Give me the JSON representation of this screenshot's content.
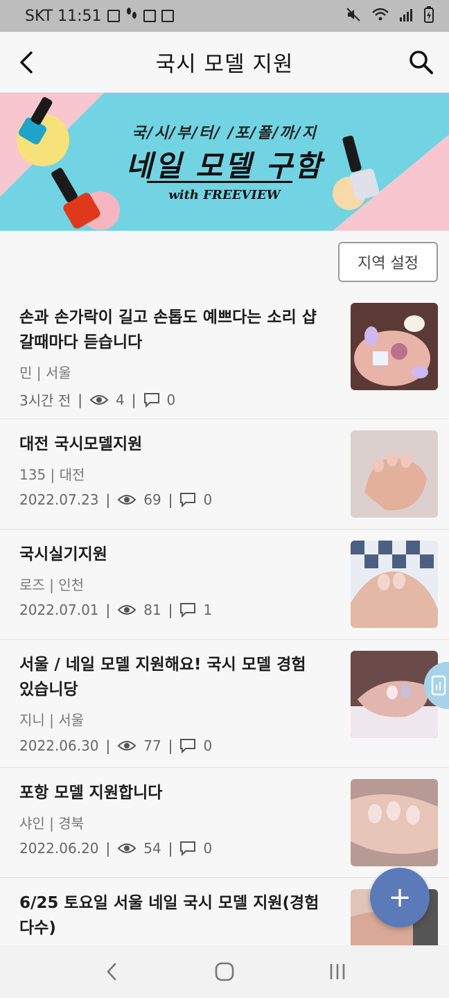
{
  "status_bar": {
    "carrier_time": "SKT 11:51"
  },
  "app_bar": {
    "title": "국시 모델 지원"
  },
  "banner": {
    "top_text": "국/시/부/터/ /포/폴/까/지",
    "main_text": "네일 모델 구함",
    "sub_text": "with FREEVIEW",
    "colors": {
      "pink": "#f7c6cf",
      "cyan": "#72d4e3"
    }
  },
  "region_button": {
    "label": "지역 설정"
  },
  "posts": [
    {
      "title": "손과 손가락이 길고 손톱도 예쁘다는 소리 샵갈때마다 듣습니다",
      "author": "민",
      "region": "서울",
      "date": "3시간 전",
      "views": "4",
      "comments": "0",
      "thumb_color": "#5b3a36"
    },
    {
      "title": "대전 국시모델지원",
      "author": "135",
      "region": "대전",
      "date": "2022.07.23",
      "views": "69",
      "comments": "0",
      "thumb_color": "#d9c8c4"
    },
    {
      "title": "국시실기지원",
      "author": "로즈",
      "region": "인천",
      "date": "2022.07.01",
      "views": "81",
      "comments": "1",
      "thumb_color": "#7d8fa6"
    },
    {
      "title": "서울 / 네일 모델 지원해요! 국시 모델 경험 있습니당",
      "author": "지니",
      "region": "서울",
      "date": "2022.06.30",
      "views": "77",
      "comments": "0",
      "thumb_color": "#8b6c6c"
    },
    {
      "title": "포항 모델 지원합니다",
      "author": "샤인",
      "region": "경북",
      "date": "2022.06.20",
      "views": "54",
      "comments": "0",
      "thumb_color": "#c9a79e"
    },
    {
      "title": "6/25 토요일 서울 네일 국시 모델 지원(경험다수)",
      "author": "",
      "region": "",
      "date": "",
      "views": "",
      "comments": "",
      "thumb_color": "#e0c4b8"
    }
  ],
  "fab": {
    "label": "+"
  },
  "nav": {
    "back": "back-nav",
    "home": "home-nav",
    "recents": "recents-nav"
  }
}
